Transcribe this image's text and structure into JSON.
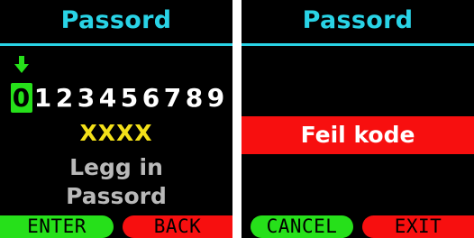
{
  "left": {
    "title": "Passord",
    "digits": [
      "0",
      "1",
      "2",
      "3",
      "4",
      "5",
      "6",
      "7",
      "8",
      "9"
    ],
    "code": "XXXX",
    "message_line1": "Legg in",
    "message_line2": "Passord",
    "buttons": {
      "enter": "ENTER",
      "back": "BACK"
    }
  },
  "right": {
    "title": "Passord",
    "error": "Feil kode",
    "buttons": {
      "cancel": "CANCEL",
      "exit": "EXIT"
    }
  },
  "icons": {
    "selector": "arrow-down-icon"
  },
  "colors": {
    "title": "#29d3e6",
    "selected": "#26e01a",
    "code": "#f3e019",
    "message": "#b9b9b9",
    "error": "#f70f0f",
    "button_green": "#26e01a",
    "button_red": "#f70f0f"
  }
}
